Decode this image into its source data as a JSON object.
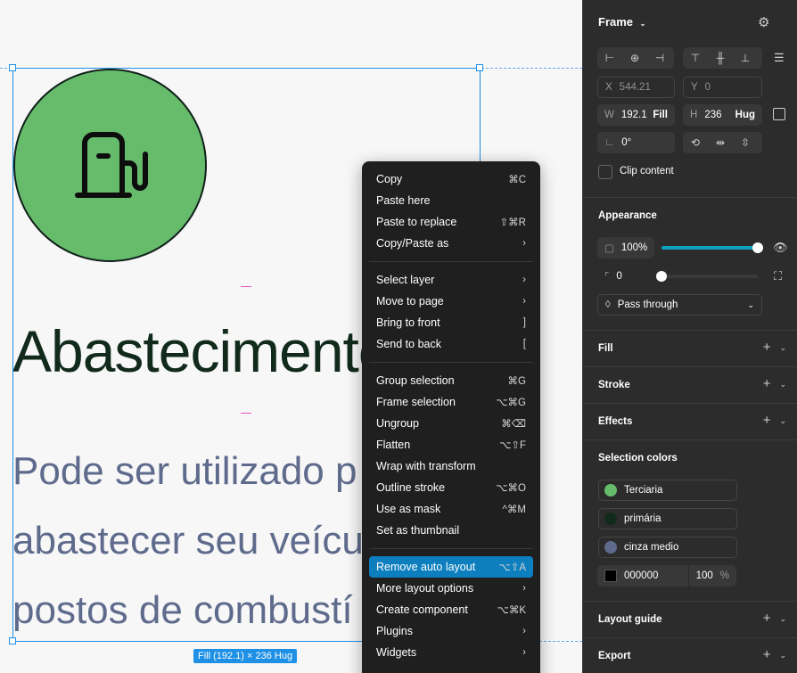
{
  "canvas": {
    "title": "Abastecimento",
    "description_lines": [
      "Pode ser utilizado p",
      "abastecer seu veícu",
      "postos de combustí"
    ],
    "size_badge": "Fill (192.1) × 236 Hug",
    "icon": "fuel-pump-icon",
    "colors": {
      "circle": "#67bc6c",
      "title": "#112a1b",
      "description": "#5f6b8c",
      "selection": "#1e90e6"
    }
  },
  "context_menu": {
    "groups": [
      [
        {
          "label": "Copy",
          "shortcut": "⌘C"
        },
        {
          "label": "Paste here",
          "shortcut": ""
        },
        {
          "label": "Paste to replace",
          "shortcut": "⇧⌘R"
        },
        {
          "label": "Copy/Paste as",
          "shortcut": "›"
        }
      ],
      [
        {
          "label": "Select layer",
          "shortcut": "›"
        },
        {
          "label": "Move to page",
          "shortcut": "›"
        },
        {
          "label": "Bring to front",
          "shortcut": "]"
        },
        {
          "label": "Send to back",
          "shortcut": "["
        }
      ],
      [
        {
          "label": "Group selection",
          "shortcut": "⌘G"
        },
        {
          "label": "Frame selection",
          "shortcut": "⌥⌘G"
        },
        {
          "label": "Ungroup",
          "shortcut": "⌘⌫"
        },
        {
          "label": "Flatten",
          "shortcut": "⌥⇧F"
        },
        {
          "label": "Wrap with transform",
          "shortcut": ""
        },
        {
          "label": "Outline stroke",
          "shortcut": "⌥⌘O"
        },
        {
          "label": "Use as mask",
          "shortcut": "^⌘M"
        },
        {
          "label": "Set as thumbnail",
          "shortcut": ""
        }
      ],
      [
        {
          "label": "Remove auto layout",
          "shortcut": "⌥⇧A",
          "active": true
        },
        {
          "label": "More layout options",
          "shortcut": "›"
        },
        {
          "label": "Create component",
          "shortcut": "⌥⌘K"
        },
        {
          "label": "Plugins",
          "shortcut": "›"
        },
        {
          "label": "Widgets",
          "shortcut": "›"
        }
      ]
    ]
  },
  "panel": {
    "header": "Frame",
    "x_label": "X",
    "x_value": "544.21",
    "y_label": "Y",
    "y_value": "0",
    "w_label": "W",
    "w_value": "192.1",
    "w_mode": "Fill",
    "h_label": "H",
    "h_value": "236",
    "h_mode": "Hug",
    "rotation": "0°",
    "clip_content": "Clip content",
    "appearance": {
      "title": "Appearance",
      "opacity": "100%",
      "opacity_level": 1.0,
      "radius": "0",
      "radius_level": 0.0,
      "blend": "Pass through"
    },
    "sections": [
      "Fill",
      "Stroke",
      "Effects"
    ],
    "selection_colors": {
      "title": "Selection colors",
      "items": [
        {
          "name": "Terciaria",
          "color": "#67bc6c"
        },
        {
          "name": "primária",
          "color": "#112a1b"
        },
        {
          "name": "cinza medio",
          "color": "#5f6b8c"
        }
      ],
      "hex": "000000",
      "hex_opacity": "100",
      "percent": "%"
    },
    "layout_guide": "Layout guide",
    "export": "Export"
  }
}
